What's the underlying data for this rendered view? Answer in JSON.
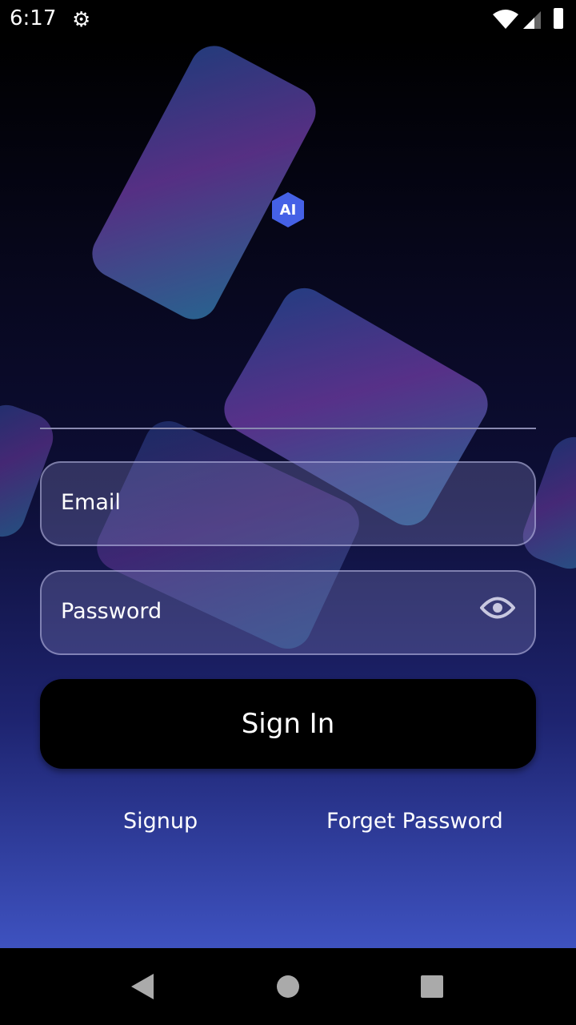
{
  "status_bar": {
    "time": "6:17"
  },
  "logo": {
    "text": "AI",
    "color": "#4561e6"
  },
  "form": {
    "email_placeholder": "Email",
    "password_placeholder": "Password",
    "signin_label": "Sign In",
    "signup_label": "Signup",
    "forget_label": "Forget Password"
  }
}
